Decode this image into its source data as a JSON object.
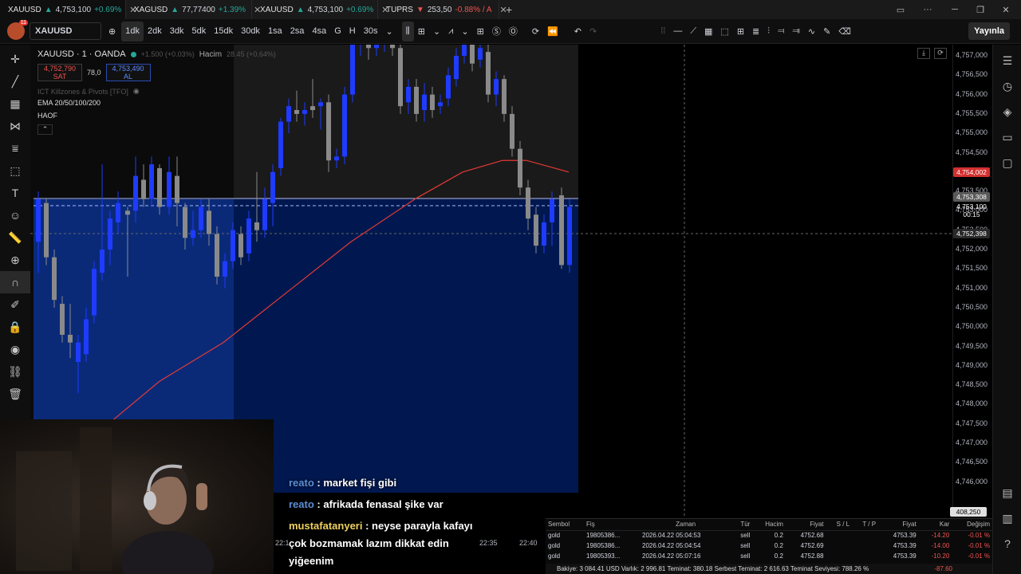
{
  "tabs": [
    {
      "symbol": "XAUUSD",
      "arrow": "▲",
      "price": "4,753,100",
      "change": "+0.69%",
      "dir": "up",
      "color": "#f0a020"
    },
    {
      "symbol": "XAGUSD",
      "arrow": "▲",
      "price": "77,77400",
      "change": "+1.39%",
      "dir": "up",
      "color": "#9aa0b0"
    },
    {
      "symbol": "XAUUSD",
      "arrow": "▲",
      "price": "4,753,100",
      "change": "+0.69%",
      "dir": "up",
      "color": "#f0a020"
    },
    {
      "symbol": "TUPRS",
      "arrow": "▼",
      "price": "253,50",
      "change": "-0.88% / A",
      "dir": "dn",
      "color": "#c62828"
    }
  ],
  "toolbar": {
    "notification_count": "11",
    "symbol": "XAUUSD",
    "intervals": [
      "1dk",
      "2dk",
      "3dk",
      "5dk",
      "15dk",
      "30dk",
      "1sa",
      "2sa",
      "4sa",
      "G",
      "H",
      "30s"
    ],
    "selected_interval": "1dk",
    "publish_label": "Yayınla"
  },
  "legend": {
    "title": "XAUUSD · 1 · OANDA",
    "change": "+1.500 (+0.03%)",
    "volume_label": "Hacim",
    "volume_value": "28.45 (+0.64%)",
    "sell_price": "4,752,790",
    "sell_label": "SAT",
    "spread": "78,0",
    "buy_price": "4,753,490",
    "buy_label": "AL",
    "indicators": [
      "ICT Killzones & Pivots [TFO]",
      "EMA 20/50/100/200",
      "HAOF"
    ]
  },
  "price_axis": {
    "ticks": [
      "4,757,000",
      "4,756,500",
      "4,756,000",
      "4,755,500",
      "4,755,000",
      "4,754,500",
      "4,754,000",
      "4,753,500",
      "4,753,000",
      "4,752,500",
      "4,752,000",
      "4,751,500",
      "4,751,000",
      "4,750,500",
      "4,750,000",
      "4,749,500",
      "4,749,000",
      "4,748,500",
      "4,748,000",
      "4,747,500",
      "4,747,000",
      "4,746,500",
      "4,746,000"
    ],
    "ema_label": "4,754,002",
    "line_label": "4,753,308",
    "last_price": "4,753,100",
    "countdown": "00:15",
    "crosshair_price": "4,752,398",
    "bottom_label": "408,250",
    "colors": {
      "ema": "#e53935",
      "candle_up": "#1f3bff",
      "candle_down": "#8a8a8a",
      "zone": "#001a55"
    }
  },
  "time_axis": [
    "22:1",
    "22:35",
    "22:40"
  ],
  "chat": [
    {
      "user": "reato",
      "message": ": market fişi gibi",
      "alt": false
    },
    {
      "user": "reato",
      "message": ": afrikada fenasal şike var",
      "alt": false
    },
    {
      "user": "mustafatanyeri",
      "message": ": neyse parayla kafayı çok bozmamak lazım dikkat edin yiğeenim",
      "alt": true
    }
  ],
  "trades": {
    "headers": [
      "Sembol",
      "Fiş",
      "Zaman",
      "Tür",
      "Hacim",
      "Fiyat",
      "S / L",
      "T / P",
      "Fiyat",
      "Kar",
      "Değişim"
    ],
    "rows": [
      {
        "symbol": "gold",
        "ticket": "19805386...",
        "time": "2026.04.22 05:04:53",
        "type": "sell",
        "volume": "0.2",
        "price": "4752.68",
        "sl": "",
        "tp": "",
        "current": "4753.39",
        "profit": "-14.20",
        "change": "-0.01 %"
      },
      {
        "symbol": "gold",
        "ticket": "19805386...",
        "time": "2026.04.22 05:04:54",
        "type": "sell",
        "volume": "0.2",
        "price": "4752.69",
        "sl": "",
        "tp": "",
        "current": "4753.39",
        "profit": "-14.00",
        "change": "-0.01 %"
      },
      {
        "symbol": "gold",
        "ticket": "19805393...",
        "time": "2026.04.22 05:07:16",
        "type": "sell",
        "volume": "0.2",
        "price": "4752.88",
        "sl": "",
        "tp": "",
        "current": "4753.39",
        "profit": "-10.20",
        "change": "-0.01 %"
      }
    ],
    "summary": "Bakiye: 3 084.41 USD  Varlık: 2 996.81  Teminat: 380.18  Serbest Teminat: 2 616.63  Teminat Seviyesi: 788.26 %",
    "summary_total": "-87.60"
  },
  "candles": [
    [
      48,
      4752.2,
      4753.3,
      4751.4,
      4753.5,
      "up"
    ],
    [
      58,
      4753.2,
      4751.8,
      4751.6,
      4753.3,
      "dn"
    ],
    [
      68,
      4751.8,
      4750.7,
      4750.5,
      4752.0,
      "dn"
    ],
    [
      78,
      4750.6,
      4749.8,
      4749.6,
      4750.8,
      "dn"
    ],
    [
      88,
      4749.8,
      4749.6,
      4749.2,
      4750.6,
      "dn"
    ],
    [
      98,
      4749.6,
      4749.1,
      4748.3,
      4749.8,
      "up"
    ],
    [
      108,
      4749.3,
      4750.2,
      4749.1,
      4750.5,
      "up"
    ],
    [
      118,
      4750.3,
      4751.5,
      4750.1,
      4751.7,
      "up"
    ],
    [
      128,
      4751.4,
      4752.0,
      4751.2,
      4754.2,
      "up"
    ],
    [
      138,
      4752.0,
      4752.8,
      4751.6,
      4753.0,
      "up"
    ],
    [
      148,
      4752.7,
      4753.2,
      4752.4,
      4753.5,
      "up"
    ],
    [
      160,
      4752.9,
      4753.0,
      4751.3,
      4753.1,
      "dn"
    ],
    [
      170,
      4753.0,
      4753.9,
      4752.7,
      4754.4,
      "up"
    ],
    [
      180,
      4753.8,
      4753.3,
      4753.1,
      4754.2,
      "dn"
    ],
    [
      190,
      4753.3,
      4754.2,
      4753.1,
      4754.4,
      "up"
    ],
    [
      200,
      4754.1,
      4753.1,
      4752.9,
      4754.2,
      "dn"
    ],
    [
      212,
      4753.1,
      4754.0,
      4752.9,
      4754.4,
      "up"
    ],
    [
      222,
      4753.9,
      4753.2,
      4752.6,
      4754.4,
      "dn"
    ],
    [
      232,
      4753.1,
      4752.3,
      4752.0,
      4753.2,
      "dn"
    ],
    [
      242,
      4752.3,
      4752.5,
      4752.1,
      4753.0,
      "up"
    ],
    [
      252,
      4752.5,
      4753.1,
      4752.3,
      4753.3,
      "up"
    ],
    [
      262,
      4753.0,
      4752.4,
      4752.1,
      4753.3,
      "dn"
    ],
    [
      272,
      4752.4,
      4751.3,
      4751.1,
      4752.6,
      "dn"
    ],
    [
      282,
      4751.3,
      4751.7,
      4751.0,
      4751.9,
      "up"
    ],
    [
      292,
      4751.7,
      4752.5,
      4751.5,
      4752.7,
      "up"
    ],
    [
      302,
      4752.4,
      4751.8,
      4751.6,
      4752.6,
      "dn"
    ],
    [
      312,
      4751.9,
      4752.8,
      4751.7,
      4753.0,
      "up"
    ],
    [
      322,
      4752.7,
      4752.5,
      4752.2,
      4754.0,
      "dn"
    ],
    [
      332,
      4752.5,
      4753.3,
      4752.3,
      4753.6,
      "up"
    ],
    [
      342,
      4753.2,
      4754.0,
      4752.6,
      4754.2,
      "up"
    ],
    [
      352,
      4754.1,
      4755.3,
      4753.9,
      4755.4,
      "up"
    ],
    [
      362,
      4755.3,
      4755.7,
      4755.0,
      4755.9,
      "up"
    ],
    [
      372,
      4755.6,
      4755.5,
      4755.3,
      4756.1,
      "dn"
    ],
    [
      382,
      4755.5,
      4755.6,
      4755.2,
      4755.8,
      "up"
    ],
    [
      392,
      4755.6,
      4755.7,
      4755.4,
      4756.4,
      "dn"
    ],
    [
      402,
      4755.7,
      4755.8,
      4755.1,
      4755.9,
      "up"
    ],
    [
      412,
      4755.8,
      4754.3,
      4754.0,
      4756.0,
      "dn"
    ],
    [
      422,
      4754.3,
      4754.4,
      4754.1,
      4754.6,
      "up"
    ],
    [
      432,
      4754.4,
      4756.0,
      4754.2,
      4756.2,
      "up"
    ],
    [
      442,
      4756.0,
      4757.4,
      4755.8,
      4757.5,
      "up"
    ],
    [
      452,
      4757.3,
      4757.6,
      4757.0,
      4757.9,
      "up"
    ],
    [
      462,
      4757.5,
      4757.2,
      4756.9,
      4757.8,
      "dn"
    ],
    [
      472,
      4757.2,
      4757.3,
      4757.0,
      4757.6,
      "up"
    ],
    [
      482,
      4757.3,
      4757.6,
      4757.1,
      4757.9,
      "up"
    ],
    [
      492,
      4757.6,
      4757.2,
      4757.0,
      4757.8,
      "dn"
    ],
    [
      502,
      4757.2,
      4755.7,
      4755.5,
      4757.3,
      "dn"
    ],
    [
      512,
      4755.8,
      4756.2,
      4755.5,
      4756.4,
      "up"
    ],
    [
      522,
      4756.2,
      4755.5,
      4755.3,
      4756.4,
      "dn"
    ],
    [
      532,
      4755.6,
      4756.0,
      4755.3,
      4756.3,
      "up"
    ],
    [
      542,
      4756.0,
      4755.6,
      4755.4,
      4756.2,
      "dn"
    ],
    [
      552,
      4755.7,
      4755.8,
      4755.5,
      4756.0,
      "up"
    ],
    [
      562,
      4755.9,
      4756.5,
      4755.7,
      4756.7,
      "up"
    ],
    [
      572,
      4756.4,
      4757.0,
      4756.2,
      4757.2,
      "up"
    ],
    [
      582,
      4757.0,
      4757.4,
      4756.8,
      4757.6,
      "up"
    ],
    [
      592,
      4757.3,
      4756.8,
      4756.6,
      4757.5,
      "dn"
    ],
    [
      602,
      4756.9,
      4757.2,
      4756.7,
      4757.4,
      "up"
    ],
    [
      612,
      4757.1,
      4756.0,
      4755.8,
      4757.3,
      "dn"
    ],
    [
      622,
      4756.0,
      4756.4,
      4755.7,
      4756.6,
      "up"
    ],
    [
      632,
      4756.4,
      4755.5,
      4755.3,
      4756.5,
      "dn"
    ],
    [
      642,
      4755.5,
      4754.6,
      4754.4,
      4755.7,
      "dn"
    ],
    [
      652,
      4754.6,
      4753.6,
      4753.4,
      4754.8,
      "dn"
    ],
    [
      662,
      4753.6,
      4752.8,
      4752.5,
      4753.8,
      "dn"
    ],
    [
      672,
      4752.9,
      4752.1,
      4751.9,
      4753.1,
      "dn"
    ],
    [
      682,
      4752.1,
      4752.7,
      4751.9,
      4752.9,
      "up"
    ],
    [
      692,
      4752.7,
      4753.3,
      4752.1,
      4753.5,
      "up"
    ],
    [
      704,
      4753.4,
      4751.6,
      4751.5,
      4753.6,
      "dn"
    ],
    [
      714,
      4751.6,
      4753.1,
      4751.4,
      4753.3,
      "up"
    ]
  ],
  "ema": [
    [
      130,
      4747.4
    ],
    [
      200,
      4748.6
    ],
    [
      280,
      4749.6
    ],
    [
      360,
      4750.9
    ],
    [
      440,
      4752.2
    ],
    [
      520,
      4753.3
    ],
    [
      580,
      4754.0
    ],
    [
      630,
      4754.3
    ],
    [
      660,
      4754.3
    ],
    [
      713,
      4754.0
    ]
  ]
}
